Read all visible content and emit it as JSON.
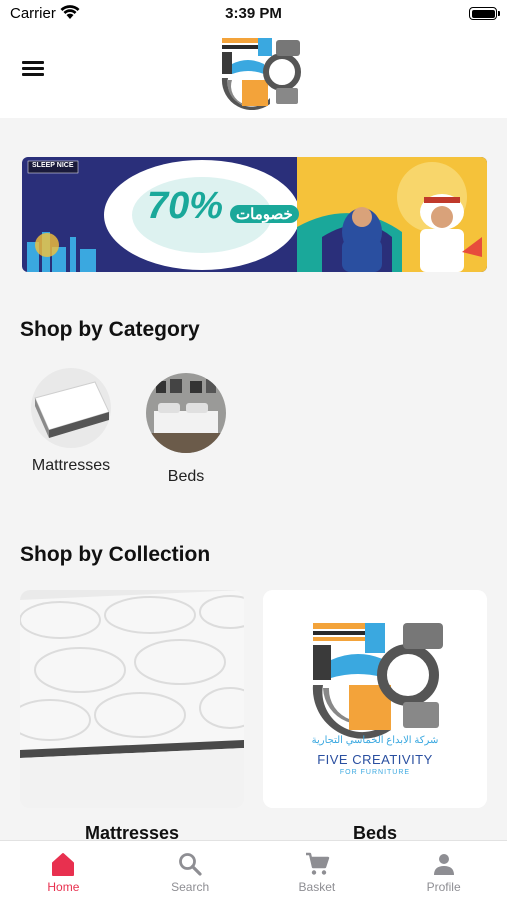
{
  "status_bar": {
    "carrier": "Carrier",
    "time": "3:39 PM"
  },
  "header": {
    "logo_icon": "five-creativity-logo-icon",
    "menu_icon": "hamburger-menu-icon"
  },
  "banner": {
    "brand": "SLEEP NICE",
    "discount": "70%",
    "arabic_text": "خصومات",
    "colors": {
      "background": "#2a2f7a",
      "accent": "#1aa89a",
      "sun": "#f5c23a"
    }
  },
  "categories": {
    "title": "Shop by Category",
    "items": [
      {
        "label": "Mattresses"
      },
      {
        "label": "Beds"
      }
    ]
  },
  "collections": {
    "title": "Shop by Collection",
    "items": [
      {
        "label": "Mattresses"
      },
      {
        "label": "Beds",
        "logo_text": "FIVE CREATIVITY",
        "logo_subtext": "FOR FURNITURE",
        "logo_arabic": "شركة الابداع الخماسي التجارية"
      }
    ]
  },
  "tabs": [
    {
      "label": "Home",
      "icon": "home-icon",
      "active": true
    },
    {
      "label": "Search",
      "icon": "search-icon",
      "active": false
    },
    {
      "label": "Basket",
      "icon": "cart-icon",
      "active": false
    },
    {
      "label": "Profile",
      "icon": "person-icon",
      "active": false
    }
  ],
  "colors": {
    "accent": "#e8304f",
    "tab_inactive": "#8e8e93",
    "page_bg": "#f4f4f4"
  }
}
